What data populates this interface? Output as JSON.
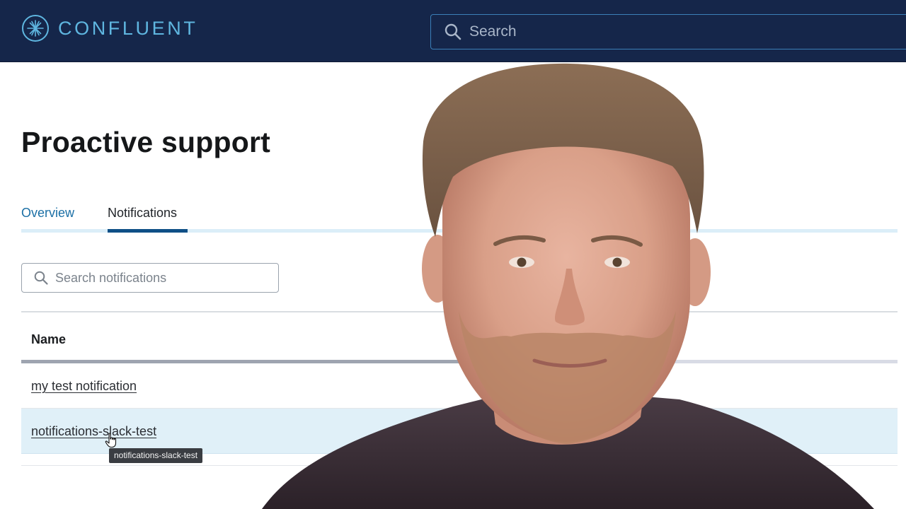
{
  "header": {
    "brand": "CONFLUENT",
    "search_placeholder": "Search"
  },
  "page": {
    "title": "Proactive support",
    "tabs": [
      {
        "label": "Overview",
        "active": false
      },
      {
        "label": "Notifications",
        "active": true
      }
    ],
    "search_notifications_placeholder": "Search notifications"
  },
  "table": {
    "columns": [
      "Name"
    ],
    "rows": [
      {
        "name": "my test notification",
        "hovered": false
      },
      {
        "name": "notifications-slack-test",
        "hovered": true
      }
    ]
  },
  "tooltip": {
    "text": "notifications-slack-test"
  },
  "icons": {
    "logo": "confluent-logo-icon",
    "search": "search-icon",
    "cursor": "hand-pointer-icon"
  },
  "colors": {
    "topbar": "#15264a",
    "brand": "#5fb6e0",
    "tab_active_underline": "#0f4f86",
    "tab_link": "#1b6fa5",
    "row_hover": "#e0f0f8"
  }
}
